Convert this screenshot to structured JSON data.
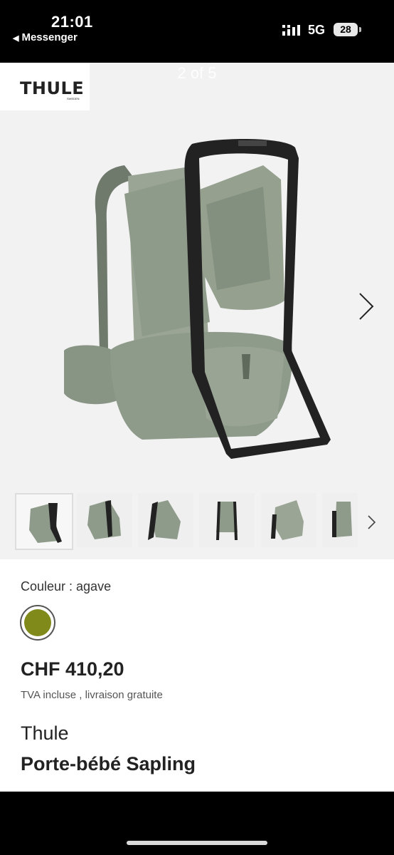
{
  "status_bar": {
    "time": "21:01",
    "back_app": "Messenger",
    "network": "5G",
    "battery": "28"
  },
  "gallery": {
    "logo_text": "THULE",
    "logo_sub": "SWEDEN",
    "pager": "2 of 5"
  },
  "product": {
    "color_label": "Couleur : agave",
    "swatch_color": "#7f8a1a",
    "price": "CHF 410,20",
    "price_note": "TVA incluse  , livraison gratuite",
    "brand": "Thule",
    "name": "Porte-bébé Sapling"
  },
  "colors": {
    "fabric": "#8e9a8a",
    "frame": "#222222"
  }
}
